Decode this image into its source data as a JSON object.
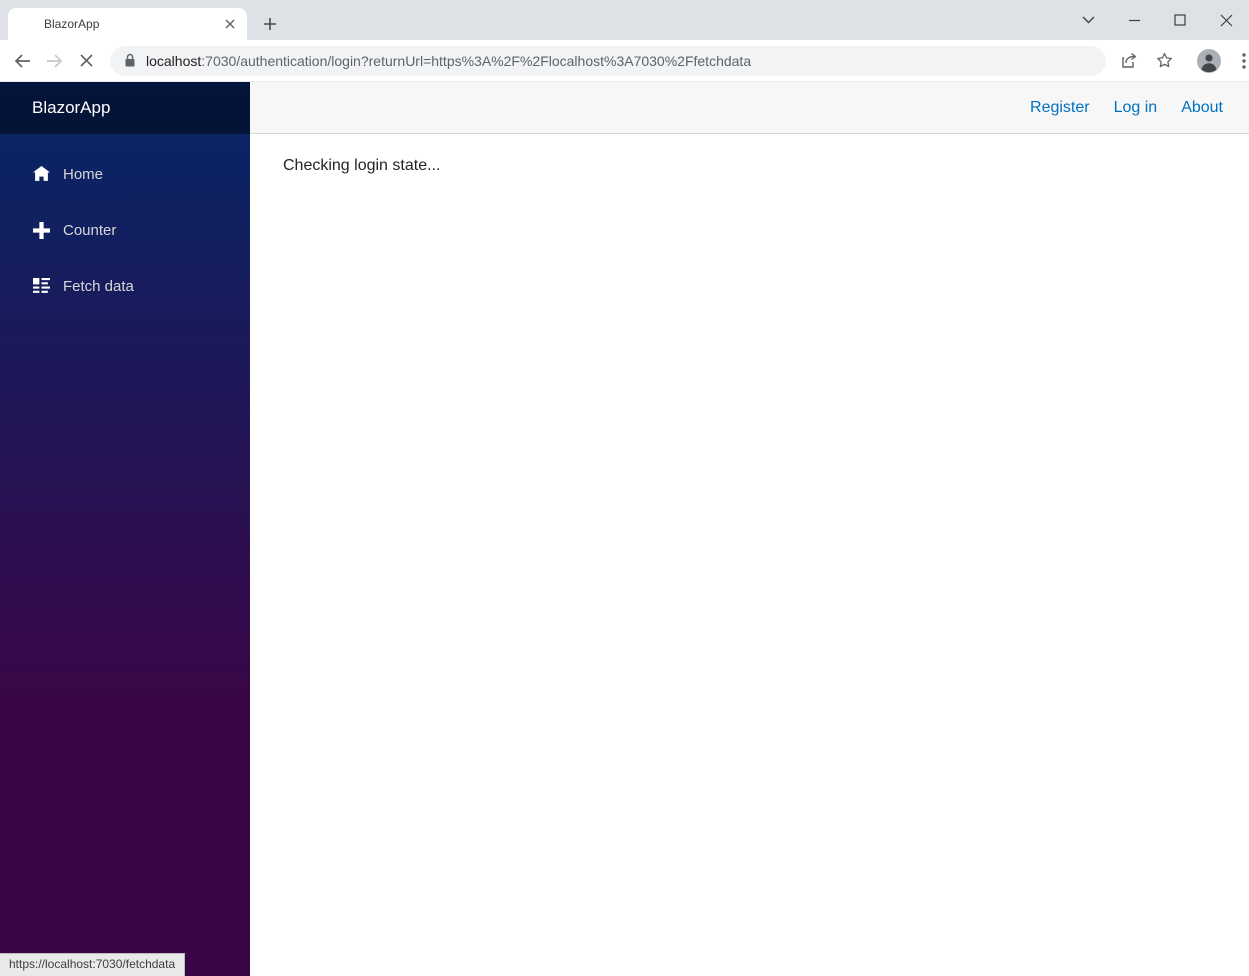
{
  "browser": {
    "tab_title": "BlazorApp",
    "url_host": "localhost",
    "url_rest": ":7030/authentication/login?returnUrl=https%3A%2F%2Flocalhost%3A7030%2Ffetchdata",
    "icons": {
      "tab_close": "close-icon",
      "new_tab": "plus-icon",
      "tab_search": "chevron-down-icon",
      "back": "arrow-left-icon",
      "forward": "arrow-right-icon",
      "stop": "close-icon",
      "security": "lock-icon",
      "share": "share-icon",
      "bookmark": "star-icon",
      "profile": "person-icon",
      "menu": "three-dots-icon"
    }
  },
  "app": {
    "brand": "BlazorApp",
    "sidebar_items": [
      {
        "label": "Home",
        "icon": "home-icon"
      },
      {
        "label": "Counter",
        "icon": "plus-icon"
      },
      {
        "label": "Fetch data",
        "icon": "list-rich-icon"
      }
    ],
    "top_links": [
      {
        "label": "Register"
      },
      {
        "label": "Log in"
      },
      {
        "label": "About"
      }
    ],
    "content_status": "Checking login state..."
  },
  "status_bar": {
    "link_preview": "https://localhost:7030/fetchdata"
  },
  "colors": {
    "link_blue": "#0071c1",
    "sidebar_gradient_top": "#052767",
    "sidebar_gradient_bottom": "#3a0647",
    "brand_row_overlay": "rgba(0,0,0,0.45)",
    "nav_text": "#d7d7d7",
    "top_row_bg": "#f7f7f7",
    "top_row_border": "#d6d5d5",
    "chrome_titlebar_bg": "#dee1e6",
    "omnibox_bg": "#f1f3f4",
    "chrome_icon_gray": "#5f6368"
  }
}
